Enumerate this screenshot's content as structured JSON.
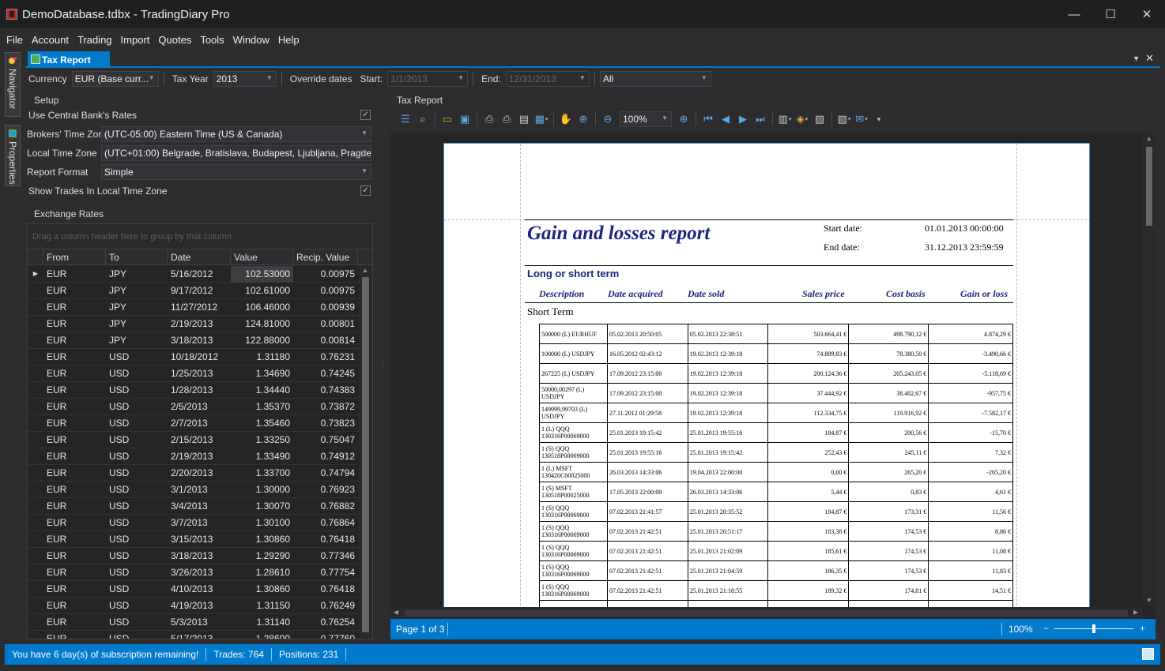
{
  "window": {
    "title": "DemoDatabase.tdbx - TradingDiary Pro",
    "controls": [
      "—",
      "☐",
      "✕"
    ]
  },
  "menu": [
    "File",
    "Account",
    "Trading",
    "Import",
    "Quotes",
    "Tools",
    "Window",
    "Help"
  ],
  "side_rail": {
    "navigator": "Navigator",
    "properties": "Properties"
  },
  "doc_tab": {
    "label": "Tax Report"
  },
  "params": {
    "currency_label": "Currency",
    "currency_value": "EUR (Base curr...",
    "tax_year_label": "Tax Year",
    "tax_year_value": "2013",
    "override_label": "Override dates",
    "start_label": "Start:",
    "start_value": "1/1/2013",
    "end_label": "End:",
    "end_value": "12/31/2013",
    "filter_value": "All"
  },
  "setup": {
    "title": "Setup",
    "use_central": "Use Central Bank's Rates",
    "broker_tz_label": "Brokers' Time Zone",
    "broker_tz_value": "(UTC-05:00) Eastern Time (US & Canada)",
    "local_tz_label": "Local Time Zone",
    "local_tz_value": "(UTC+01:00) Belgrade, Bratislava, Budapest, Ljubljana, Prague",
    "format_label": "Report Format",
    "format_value": "Simple",
    "show_local": "Show Trades In Local Time Zone"
  },
  "exchange": {
    "title": "Exchange Rates",
    "group_hint": "Drag a column header here to group by that column",
    "columns": [
      "From",
      "To",
      "Date",
      "Value",
      "Recip. Value"
    ],
    "rows": [
      [
        "EUR",
        "JPY",
        "5/16/2012",
        "102.53000",
        "0.00975"
      ],
      [
        "EUR",
        "JPY",
        "9/17/2012",
        "102.61000",
        "0.00975"
      ],
      [
        "EUR",
        "JPY",
        "11/27/2012",
        "106.46000",
        "0.00939"
      ],
      [
        "EUR",
        "JPY",
        "2/19/2013",
        "124.81000",
        "0.00801"
      ],
      [
        "EUR",
        "JPY",
        "3/18/2013",
        "122.88000",
        "0.00814"
      ],
      [
        "EUR",
        "USD",
        "10/18/2012",
        "1.31180",
        "0.76231"
      ],
      [
        "EUR",
        "USD",
        "1/25/2013",
        "1.34690",
        "0.74245"
      ],
      [
        "EUR",
        "USD",
        "1/28/2013",
        "1.34440",
        "0.74383"
      ],
      [
        "EUR",
        "USD",
        "2/5/2013",
        "1.35370",
        "0.73872"
      ],
      [
        "EUR",
        "USD",
        "2/7/2013",
        "1.35460",
        "0.73823"
      ],
      [
        "EUR",
        "USD",
        "2/15/2013",
        "1.33250",
        "0.75047"
      ],
      [
        "EUR",
        "USD",
        "2/19/2013",
        "1.33490",
        "0.74912"
      ],
      [
        "EUR",
        "USD",
        "2/20/2013",
        "1.33700",
        "0.74794"
      ],
      [
        "EUR",
        "USD",
        "3/1/2013",
        "1.30000",
        "0.76923"
      ],
      [
        "EUR",
        "USD",
        "3/4/2013",
        "1.30070",
        "0.76882"
      ],
      [
        "EUR",
        "USD",
        "3/7/2013",
        "1.30100",
        "0.76864"
      ],
      [
        "EUR",
        "USD",
        "3/15/2013",
        "1.30860",
        "0.76418"
      ],
      [
        "EUR",
        "USD",
        "3/18/2013",
        "1.29290",
        "0.77346"
      ],
      [
        "EUR",
        "USD",
        "3/26/2013",
        "1.28610",
        "0.77754"
      ],
      [
        "EUR",
        "USD",
        "4/10/2013",
        "1.30860",
        "0.76418"
      ],
      [
        "EUR",
        "USD",
        "4/19/2013",
        "1.31150",
        "0.76249"
      ],
      [
        "EUR",
        "USD",
        "5/3/2013",
        "1.31140",
        "0.76254"
      ],
      [
        "EUR",
        "USD",
        "5/17/2013",
        "1.28600",
        "0.77760"
      ]
    ]
  },
  "report_panel": {
    "title": "Tax Report",
    "zoom_value": "100%",
    "page_status": "Page 1 of 3",
    "zoom_status": "100%",
    "zoom_minus": "−",
    "zoom_plus": "+",
    "zoom_level": 0.5
  },
  "report": {
    "title": "Gain and losses report",
    "start_label": "Start date:",
    "start_value": "01.01.2013 00:00:00",
    "end_label": "End date:",
    "end_value": "31.12.2013 23:59:59",
    "section": "Long or short term",
    "headers": [
      "Description",
      "Date acquired",
      "Date sold",
      "Sales price",
      "Cost basis",
      "Gain or loss"
    ],
    "short_term": "Short Term",
    "rows": [
      [
        "500000 (L) EURHUF",
        "05.02.2013 20:50:05",
        "05.02.2013 22:38:51",
        "503.664,41 €",
        "498.790,12 €",
        "4.874,29 €"
      ],
      [
        "100000 (L) USDJPY",
        "16.05.2012 02:43:12",
        "19.02.2013 12:39:18",
        "74.889,83 €",
        "78.380,50 €",
        "-3.490,66 €"
      ],
      [
        "267225 (L) USDJPY",
        "17.09.2012 23:15:00",
        "19.02.2013 12:39:18",
        "200.124,36 €",
        "205.243,05 €",
        "-5.118,69 €"
      ],
      [
        "50000,00297 (L) USDJPY",
        "17.09.2012 23:15:00",
        "19.02.2013 12:39:18",
        "37.444,92 €",
        "38.402,67 €",
        "-957,75 €"
      ],
      [
        "149999,99703 (L) USDJPY",
        "27.11.2012 01:29:58",
        "19.02.2013 12:39:18",
        "112.334,75 €",
        "119.916,92 €",
        "-7.582,17 €"
      ],
      [
        "1 (L) QQQ 130316P00069000",
        "25.01.2013 19:15:42",
        "25.01.2013 19:55:16",
        "184,87 €",
        "200,56 €",
        "-15,70 €"
      ],
      [
        "1 (S) QQQ 130518P00069000",
        "25.01.2013 19:55:16",
        "25.01.2013 19:15:42",
        "252,43 €",
        "245,11 €",
        "7,32 €"
      ],
      [
        "1 (L) MSFT 130420C00025000",
        "26.03.2013 14:33:06",
        "19.04.2013 22:00:00",
        "0,00 €",
        "265,20 €",
        "-265,20 €"
      ],
      [
        "1 (S) MSFT 130518P00025000",
        "17.05.2013 22:00:00",
        "26.03.2013 14:33:06",
        "5,44 €",
        "0,83 €",
        "4,61 €"
      ],
      [
        "1 (S) QQQ 130316P00069000",
        "07.02.2013 21:41:57",
        "25.01.2013 20:35:52",
        "184,87 €",
        "173,31 €",
        "11,56 €"
      ],
      [
        "1 (S) QQQ 130316P00069000",
        "07.02.2013 21:42:51",
        "25.01.2013 20:51:17",
        "183,38 €",
        "174,53 €",
        "8,86 €"
      ],
      [
        "1 (S) QQQ 130316P00069000",
        "07.02.2013 21:42:51",
        "25.01.2013 21:02:09",
        "185,61 €",
        "174,53 €",
        "11,08 €"
      ],
      [
        "1 (S) QQQ 130316P00069000",
        "07.02.2013 21:42:51",
        "25.01.2013 21:04:59",
        "186,35 €",
        "174,53 €",
        "11,83 €"
      ],
      [
        "1 (S) QQQ 130316P00069000",
        "07.02.2013 21:42:51",
        "25.01.2013 21:18:55",
        "189,32 €",
        "174,81 €",
        "14,51 €"
      ],
      [
        "1 (S) QQQ",
        "",
        "",
        "",
        "",
        ""
      ]
    ]
  },
  "statusbar": {
    "subscription": "You have 6 day(s) of subscription remaining!",
    "trades": "Trades: 764",
    "positions": "Positions: 231"
  },
  "colors": {
    "accent": "#007acc",
    "background": "#2d2d30",
    "report_blue": "#1a237e"
  }
}
